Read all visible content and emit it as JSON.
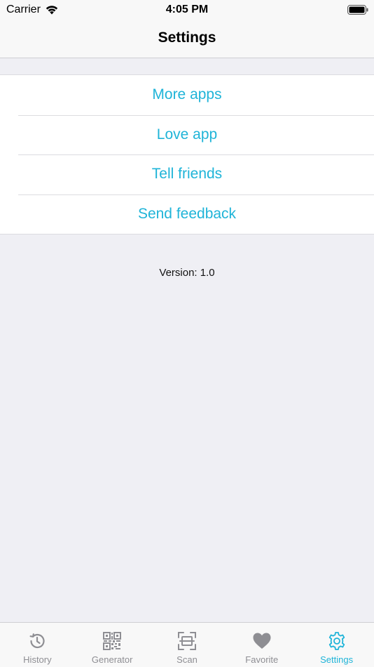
{
  "status_bar": {
    "carrier": "Carrier",
    "time": "4:05 PM",
    "icons": [
      "wifi-icon",
      "battery-icon"
    ]
  },
  "nav": {
    "title": "Settings"
  },
  "menu": {
    "items": [
      {
        "label": "More apps"
      },
      {
        "label": "Love app"
      },
      {
        "label": "Tell friends"
      },
      {
        "label": "Send feedback"
      }
    ]
  },
  "version": "Version: 1.0",
  "colors": {
    "accent": "#1fb4d8",
    "tab_inactive": "#8e8e93",
    "background": "#efeff4"
  },
  "tab_bar": {
    "tabs": [
      {
        "label": "History",
        "icon": "history-icon",
        "active": false
      },
      {
        "label": "Generator",
        "icon": "qr-code-icon",
        "active": false
      },
      {
        "label": "Scan",
        "icon": "scan-icon",
        "active": false
      },
      {
        "label": "Favorite",
        "icon": "heart-icon",
        "active": false
      },
      {
        "label": "Settings",
        "icon": "gear-icon",
        "active": true
      }
    ]
  }
}
